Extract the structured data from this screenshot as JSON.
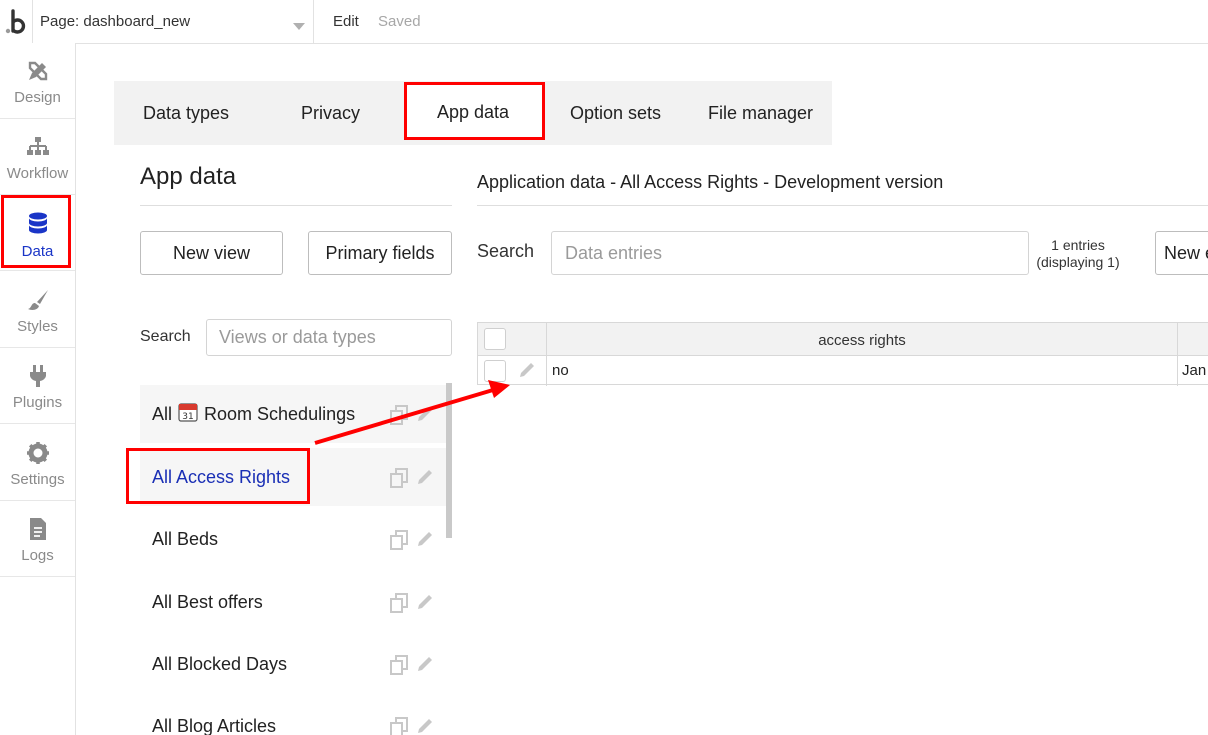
{
  "topbar": {
    "page_label": "Page: dashboard_new",
    "edit_label": "Edit",
    "saved_label": "Saved"
  },
  "sidebar": {
    "items": [
      {
        "label": "Design",
        "icon": "design-icon"
      },
      {
        "label": "Workflow",
        "icon": "workflow-icon"
      },
      {
        "label": "Data",
        "icon": "database-icon",
        "active": true
      },
      {
        "label": "Styles",
        "icon": "brush-icon"
      },
      {
        "label": "Plugins",
        "icon": "plug-icon"
      },
      {
        "label": "Settings",
        "icon": "gear-icon"
      },
      {
        "label": "Logs",
        "icon": "document-icon"
      }
    ]
  },
  "tabs": [
    {
      "label": "Data types"
    },
    {
      "label": "Privacy"
    },
    {
      "label": "App data",
      "active": true
    },
    {
      "label": "Option sets"
    },
    {
      "label": "File manager"
    }
  ],
  "left_panel": {
    "title": "App data",
    "new_view_label": "New view",
    "primary_fields_label": "Primary fields",
    "search_label": "Search",
    "search_placeholder": "Views or data types",
    "views": [
      {
        "prefix": "All",
        "name": "Room Schedulings",
        "has_calendar_icon": true
      },
      {
        "label": "All Access Rights",
        "selected": true
      },
      {
        "label": "All Beds"
      },
      {
        "label": "All Best offers"
      },
      {
        "label": "All Blocked Days"
      },
      {
        "label": "All Blog Articles"
      }
    ]
  },
  "right_panel": {
    "title": "Application data - All Access Rights - Development version",
    "search_label": "Search",
    "search_placeholder": "Data entries",
    "entries_count_line1": "1 entries",
    "entries_count_line2": "(displaying 1)",
    "new_entry_label": "New e",
    "table": {
      "columns": [
        "access rights"
      ],
      "rows": [
        {
          "access_rights": "no",
          "date_partial": "Jan"
        }
      ]
    }
  },
  "colors": {
    "accent": "#1a35c7",
    "annotation": "#ff0000",
    "selected_text": "#1a2fb5"
  }
}
